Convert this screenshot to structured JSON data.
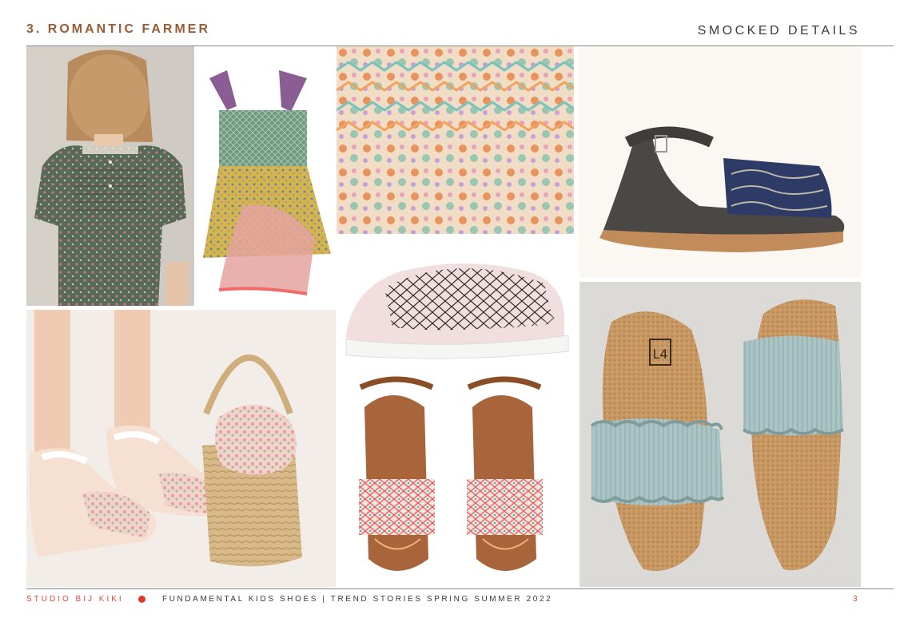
{
  "header": {
    "section_title": "3. ROMANTIC FARMER",
    "topic": "SMOCKED DETAILS"
  },
  "footer": {
    "studio": "STUDIO BIJ KIKI",
    "collection": "FUNDAMENTAL KIDS SHOES | TREND STORIES SPRING SUMMER 2022",
    "page_number": "3"
  },
  "photos": [
    {
      "id": "girl-smocked-dress-back",
      "icon": "girl-smocked-dress-back-photo"
    },
    {
      "id": "floral-smocked-dress",
      "icon": "floral-smocked-dress-photo"
    },
    {
      "id": "smocked-fabric-closeup",
      "icon": "smocked-fabric-closeup-photo"
    },
    {
      "id": "dark-leather-smocked-sandal",
      "icon": "dark-leather-sandal-photo"
    },
    {
      "id": "kids-sandals-and-basket",
      "icon": "kids-sandals-basket-photo"
    },
    {
      "id": "pink-smocked-sneakers",
      "icon": "pink-smocked-sneaker-photo"
    },
    {
      "id": "tan-embroidered-sandals",
      "icon": "tan-embroidered-sandals-photo"
    },
    {
      "id": "cork-ruffle-slides",
      "icon": "cork-ruffle-slides-photo"
    }
  ],
  "slide_logo_text": "L4",
  "colors": {
    "title_accent": "#9a5a33",
    "footer_accent": "#e04a3c",
    "dot": "#e0372a",
    "rule": "#8a8a8a"
  }
}
